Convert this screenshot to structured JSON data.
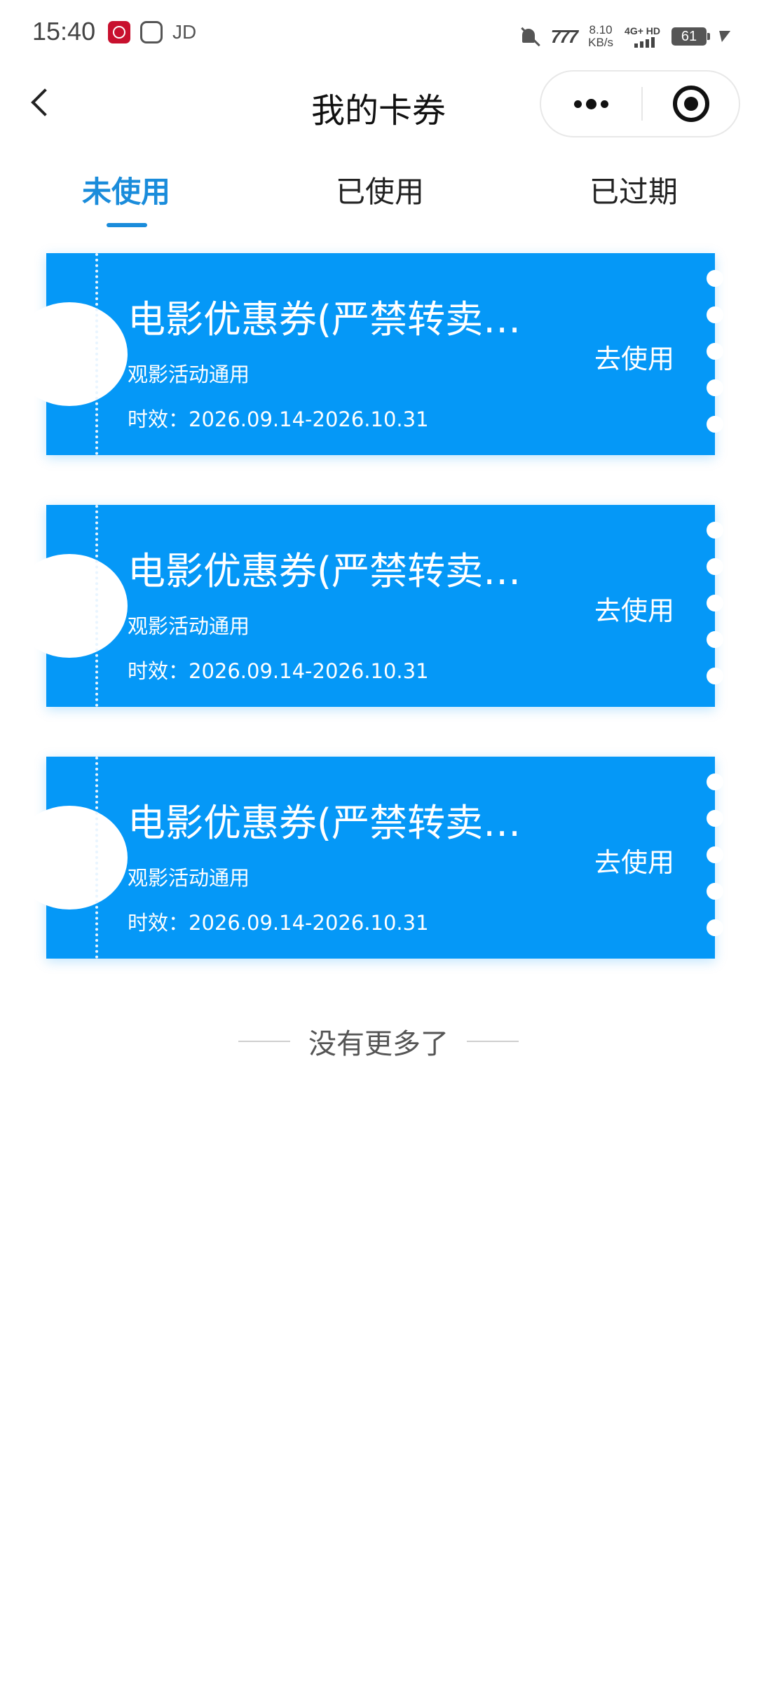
{
  "status_bar": {
    "time": "15:40",
    "app_label": "JD",
    "carrier_logo": "7?7",
    "net_speed_value": "8.10",
    "net_speed_unit": "KB/s",
    "network_type": "4G+ HD",
    "battery": "61"
  },
  "nav": {
    "title": "我的卡券"
  },
  "tabs": [
    {
      "label": "未使用",
      "active": true
    },
    {
      "label": "已使用",
      "active": false
    },
    {
      "label": "已过期",
      "active": false
    }
  ],
  "coupons": [
    {
      "title": "电影优惠券(严禁转卖…",
      "scope": "观影活动通用",
      "validity": "时效：2026.09.14-2026.10.31",
      "action": "去使用"
    },
    {
      "title": "电影优惠券(严禁转卖…",
      "scope": "观影活动通用",
      "validity": "时效：2026.09.14-2026.10.31",
      "action": "去使用"
    },
    {
      "title": "电影优惠券(严禁转卖…",
      "scope": "观影活动通用",
      "validity": "时效：2026.09.14-2026.10.31",
      "action": "去使用"
    }
  ],
  "footer": {
    "no_more": "没有更多了"
  },
  "colors": {
    "accent": "#1a8cdb",
    "coupon_bg": "#0598f7"
  }
}
